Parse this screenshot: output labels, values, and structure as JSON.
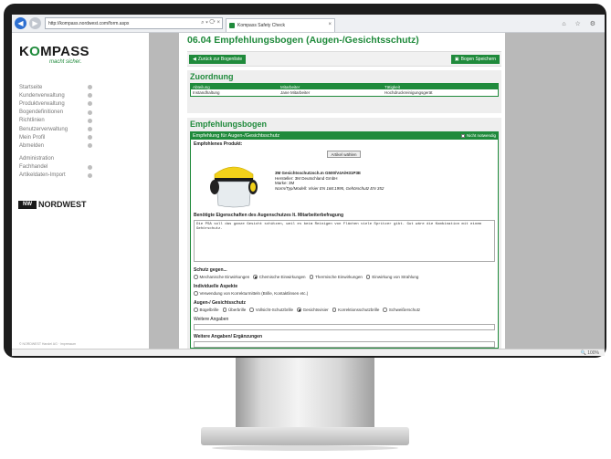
{
  "browser": {
    "url": "http://kompass.nordwest.com/form.aspx",
    "tab_title": "Kompass Safety Check",
    "zoom": "100%"
  },
  "sidebar": {
    "logo": "KOMPASS",
    "tagline": "macht sicher.",
    "items": [
      {
        "label": "Startseite"
      },
      {
        "label": "Kundenverwaltung"
      },
      {
        "label": "Produktverwaltung"
      },
      {
        "label": "Bogendefinitionen"
      },
      {
        "label": "Richtlinien"
      },
      {
        "label": "Benutzerverwaltung"
      },
      {
        "label": "Mein Profil"
      },
      {
        "label": "Abmelden"
      }
    ],
    "items2": [
      {
        "label": "Administration"
      },
      {
        "label": "Fachhandel"
      },
      {
        "label": "Artikeldaten-Import"
      }
    ],
    "partner_logo": "NORDWEST",
    "partner_mark": "NW",
    "copyright": "© NORDWEST Handel AG · Impressum"
  },
  "page": {
    "title": "06.04 Empfehlungsbogen (Augen-/Gesichtsschutz)",
    "back_button": "Zurück zur Bogenliste",
    "save_button": "Bogen Speichern"
  },
  "zuordnung": {
    "heading": "Zuordnung",
    "columns": [
      "Abteilung",
      "Mitarbeiter",
      "Tätigkeit"
    ],
    "row": [
      "Instandhaltung",
      "Jane Mitarbeiter",
      "Hochdruckreinigungsgerät"
    ]
  },
  "empfehlung": {
    "heading": "Empfehlungsbogen",
    "box_title": "Empfehlung für Augen-/Gesichtsschutz",
    "not_needed": "Nicht notwendig",
    "product_label": "Empfohlenes Produkt:",
    "choose_button": "Artikel wählen",
    "product": {
      "name": "3M Gesichtsschutzsch.m G500/V4A/H31P3E",
      "manufacturer": "Hersteller: 3M Deutschland GmbH",
      "brand": "Marke: 3M",
      "norm": "Norm/Typ/Modell: Visier EN 166:1995, Gehörschutz EN 352"
    },
    "properties_label": "Benötigte Eigenschaften des Augenschutzes lt. Mitarbeiterbefragung",
    "properties_text": "Die PSA soll das ganze Gesicht schützen, weil es beim Reinigen von Flächen viele Spritzer gibt. Gut wäre die Kombination mit einem Gehörschutz.",
    "protect_label": "Schutz gegen...",
    "protect_options": [
      "Mechanische Einwirkungen",
      "Chemische Einwirkungen",
      "Thermische Einwirkungen",
      "Einwirkung von Strahlung"
    ],
    "individual_label": "Individuelle Aspekte",
    "individual_options": [
      "Verwendung von Korrekturmitteln (Brille, Kontaktlinsen etc.)"
    ],
    "type_label": "Augen-/ Gesichtsschutz",
    "type_options": [
      "Bügelbrille",
      "Überbrille",
      "Vollsicht-Schutzbrille",
      "Gesichtsvisier",
      "Korrektionsschutzbrille",
      "Schweißerschutz"
    ],
    "more_label": "Weitere Angaben",
    "more_label2": "Weitere Angaben/ Ergänzungen"
  }
}
